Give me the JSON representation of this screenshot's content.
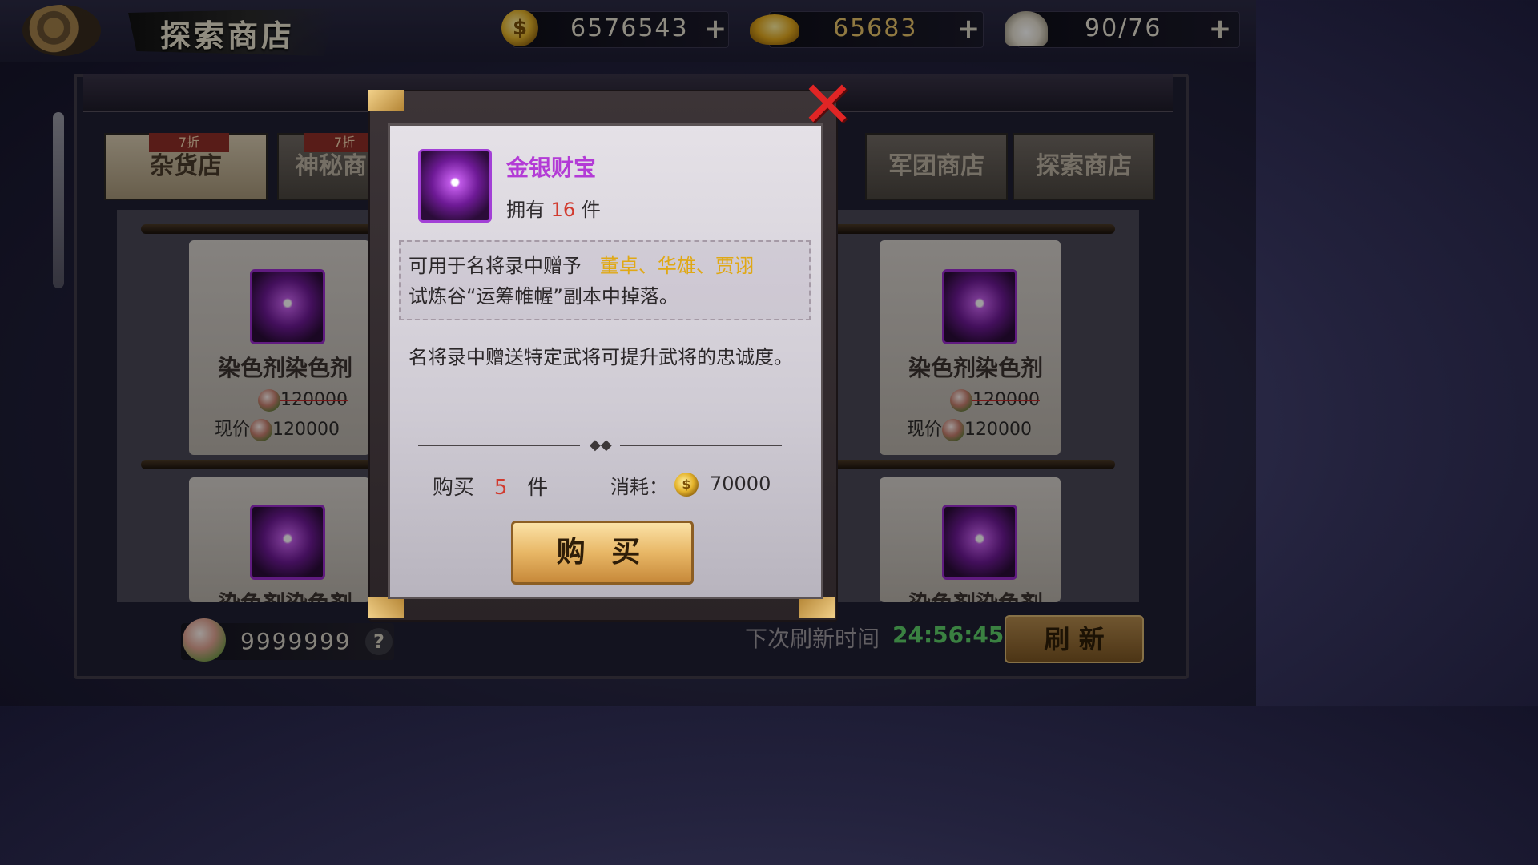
{
  "header": {
    "title": "探索商店",
    "gold": "6576543",
    "ingot": "65683",
    "stamina": "90/76"
  },
  "tabs": [
    {
      "label": "杂货店",
      "discount": "7折"
    },
    {
      "label": "神秘商",
      "discount": "7折"
    },
    {
      "label": "军团商店"
    },
    {
      "label": "探索商店"
    }
  ],
  "cards": [
    {
      "name": "染色剂染色剂",
      "old_price": "120000",
      "price_label": "现价",
      "price": "120000"
    },
    {
      "name": "染色剂染色剂",
      "old_price": "120000",
      "price_label": "现价",
      "price": "120000"
    },
    {
      "name": "染色剂染色剂"
    },
    {
      "name": "染色剂染色剂"
    }
  ],
  "footer": {
    "peach_count": "9999999",
    "help_icon": "?",
    "refresh_label": "下次刷新时间",
    "refresh_time": "24:56:45",
    "refresh_button": "刷 新"
  },
  "modal": {
    "item_name": "金银财宝",
    "own_prefix": "拥有",
    "own_count": "16",
    "own_suffix": "件",
    "desc_line1": "可用于名将录中赠予",
    "desc_names": "董卓、华雄、贾诩",
    "desc_line2": "试炼谷“运筹帷幄”副本中掉落。",
    "desc_extra": "名将录中赠送特定武将可提升武将的忠诚度。",
    "buy_prefix": "购买",
    "buy_count": "5",
    "buy_suffix": "件",
    "cost_label": "消耗：",
    "cost_value": "70000",
    "buy_button": "购 买",
    "close_icon": "✕"
  },
  "colors": {
    "gold_text": "#e6c168",
    "ingot_text": "#e8c46a",
    "stamina_text": "#e9e4d6",
    "refresh_time": "#5ed16a"
  }
}
